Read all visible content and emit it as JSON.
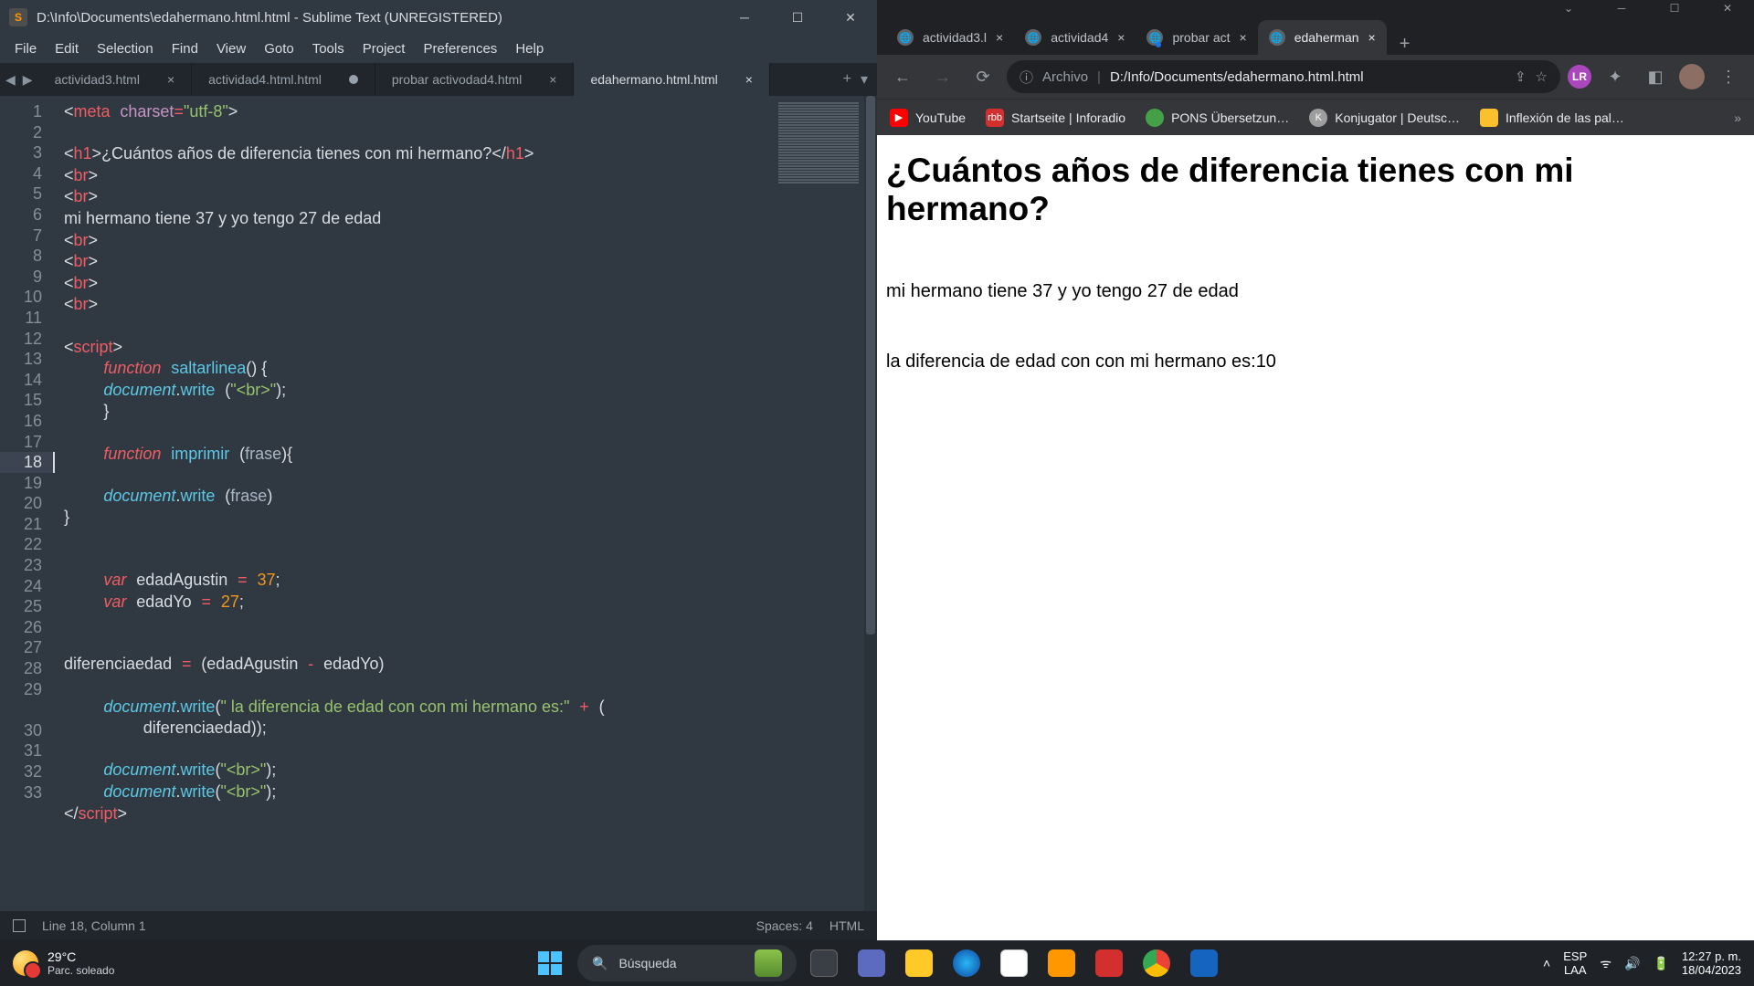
{
  "sublime": {
    "title": "D:\\Info\\Documents\\edahermano.html.html - Sublime Text (UNREGISTERED)",
    "menu": [
      "File",
      "Edit",
      "Selection",
      "Find",
      "View",
      "Goto",
      "Tools",
      "Project",
      "Preferences",
      "Help"
    ],
    "tabs": [
      {
        "label": "actividad3.html",
        "dirty": false
      },
      {
        "label": "actividad4.html.html",
        "dirty": true
      },
      {
        "label": "probar activodad4.html",
        "dirty": false
      },
      {
        "label": "edahermano.html.html",
        "dirty": false,
        "active": true
      }
    ],
    "status": {
      "pos": "Line 18, Column 1",
      "spaces": "Spaces: 4",
      "lang": "HTML"
    },
    "code": {
      "meta_attr": "charset",
      "meta_val": "\"utf-8\"",
      "h1_text": "¿Cuántos años de diferencia tienes con mi hermano?",
      "line6": "mi hermano tiene 37 y yo tengo 27 de edad",
      "fn1": "saltarlinea",
      "fn2": "imprimir",
      "param": "frase",
      "var1": "edadAgustin",
      "val1": "37",
      "var2": "edadYo",
      "val2": "27",
      "dvar": "diferenciaedad",
      "writestr": "\" la diferencia de edad con con mi hermano es:\"",
      "wrapvar": "diferenciaedad",
      "brstr": "\"<br>\""
    }
  },
  "chrome": {
    "tabs": [
      {
        "label": "actividad3.l"
      },
      {
        "label": "actividad4"
      },
      {
        "label": "probar act",
        "badge": true
      },
      {
        "label": "edaherman",
        "active": true
      }
    ],
    "omnibox": {
      "scheme": "Archivo",
      "sep": "|",
      "url": "D:/Info/Documents/edahermano.html.html"
    },
    "bookmarks": [
      {
        "label": "YouTube",
        "color": "#ff0000"
      },
      {
        "label": "Startseite | Inforadio",
        "color": "#d32f2f"
      },
      {
        "label": "PONS Übersetzun…",
        "color": "#43a047"
      },
      {
        "label": "Konjugator | Deutsc…",
        "color": "#9e9e9e"
      },
      {
        "label": "Inflexión de las pal…",
        "color": "#fbc02d"
      }
    ],
    "page": {
      "h1": "¿Cuántos años de diferencia tienes con mi hermano?",
      "p1": "mi hermano tiene 37 y yo tengo 27 de edad",
      "p2": "la diferencia de edad con con mi hermano es:10"
    }
  },
  "taskbar": {
    "weather_temp": "29°C",
    "weather_desc": "Parc. soleado",
    "search_placeholder": "Búsqueda",
    "lang1": "ESP",
    "lang2": "LAA",
    "time": "12:27 p. m.",
    "date": "18/04/2023"
  }
}
